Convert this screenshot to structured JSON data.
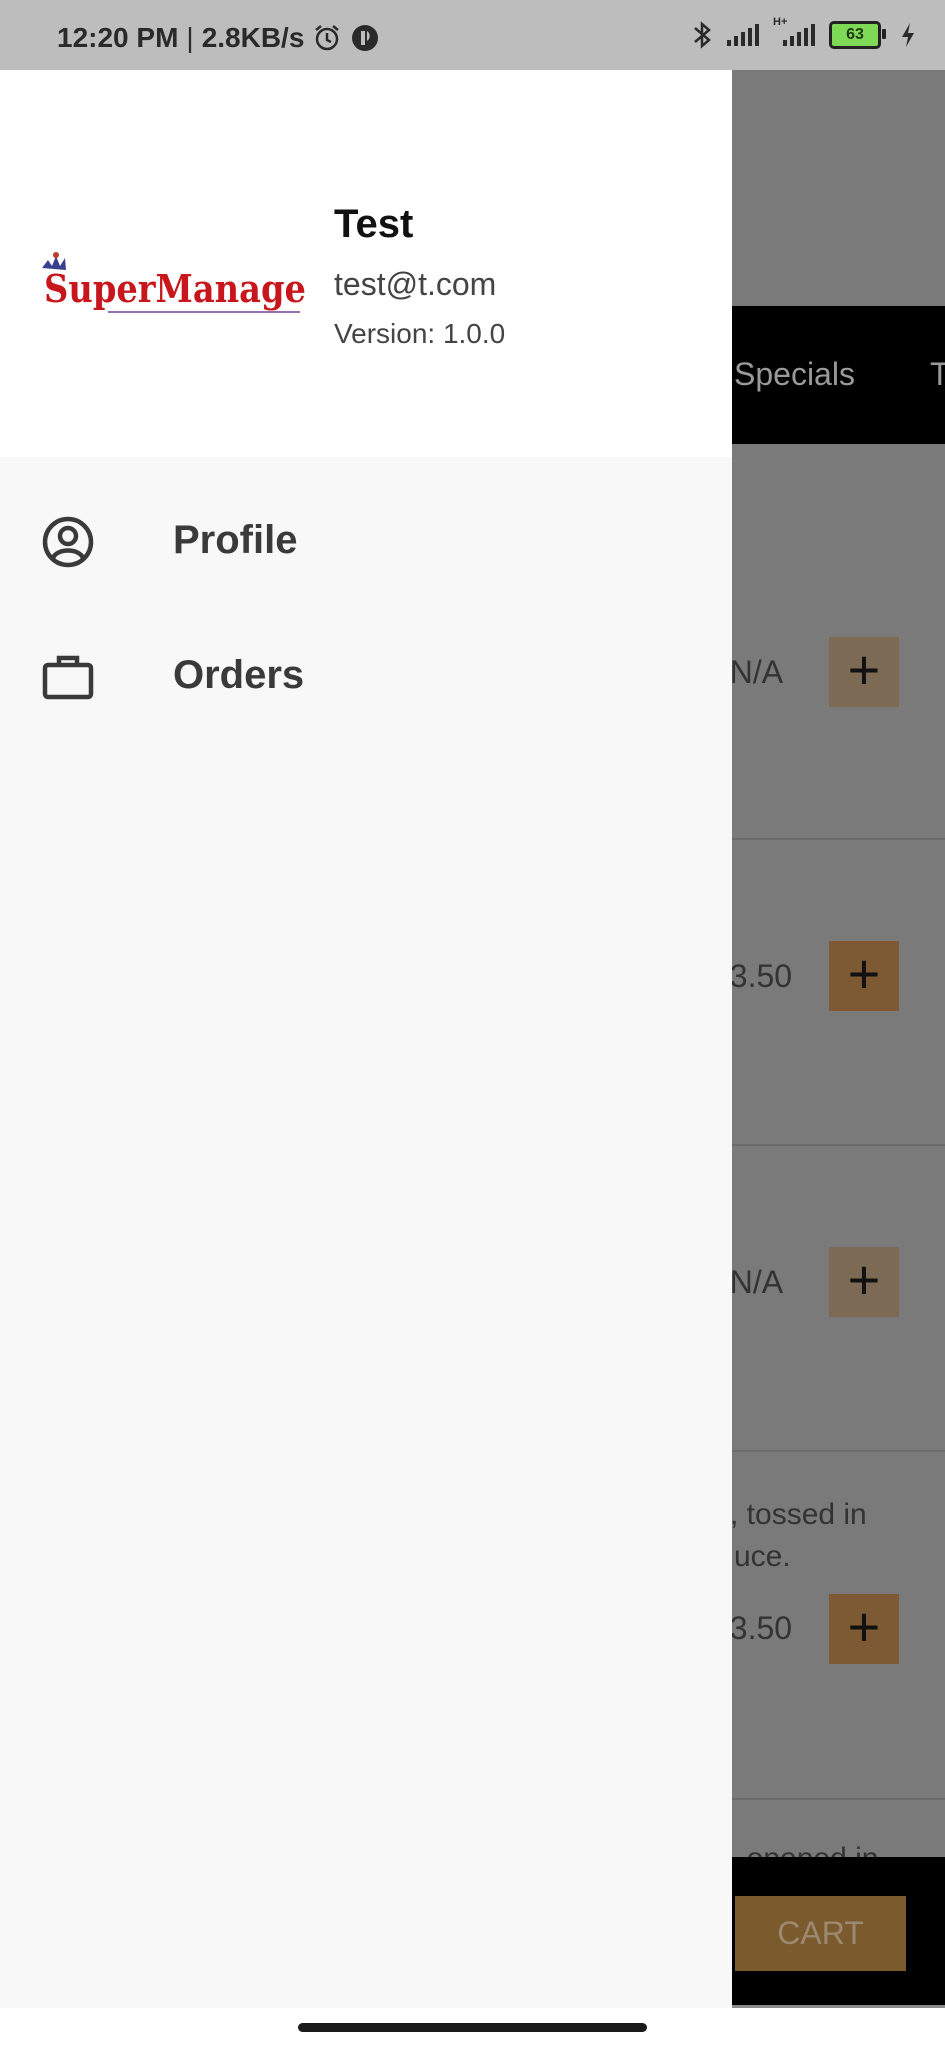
{
  "status_bar": {
    "time": "12:20 PM",
    "separator": "|",
    "speed": "2.8KB/s",
    "battery": "63",
    "network_label": "H+"
  },
  "drawer": {
    "logo_text": "SuperManage",
    "user_name": "Test",
    "user_email": "test@t.com",
    "version": "Version: 1.0.0",
    "menu": [
      {
        "label": "Profile",
        "icon": "user-circle-icon"
      },
      {
        "label": "Orders",
        "icon": "briefcase-icon"
      }
    ]
  },
  "background_app": {
    "categories": [
      "Specials",
      "T"
    ],
    "rows": [
      {
        "price": "£N/A"
      },
      {
        "price": "£3.50"
      },
      {
        "price": "£N/A"
      },
      {
        "desc_line1": ", tossed in",
        "desc_line2": "uce.",
        "price": "£3.50"
      },
      {
        "desc_line1": ", opened in"
      }
    ],
    "plus_symbol": "+",
    "cart_label": "CART"
  },
  "colors": {
    "accent": "#c8873a",
    "scrim": "rgba(0,0,0,0.5)"
  }
}
